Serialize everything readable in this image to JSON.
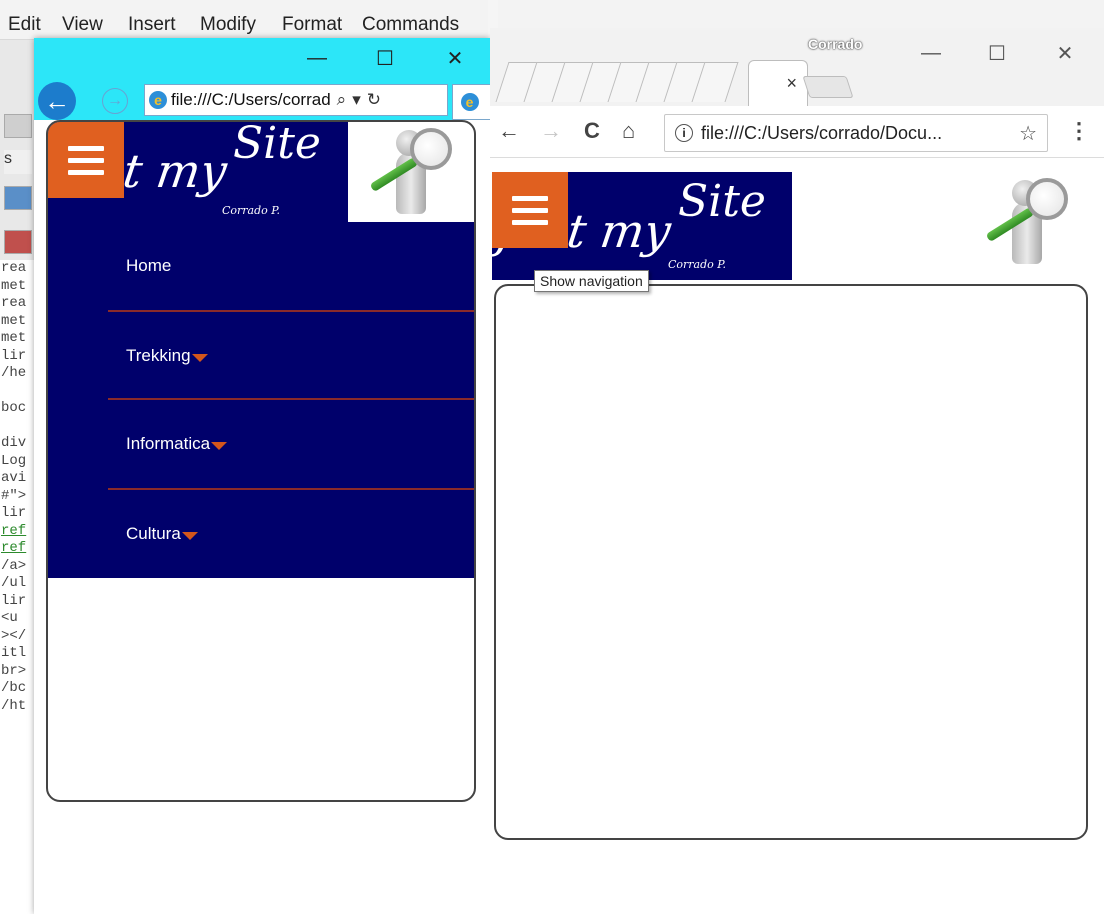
{
  "editor": {
    "menu": [
      "Edit",
      "View",
      "Insert",
      "Modify",
      "Format",
      "Commands"
    ],
    "code_lines": [
      "rea",
      "met",
      "rea",
      "met",
      "met",
      "lir",
      "/he",
      "",
      "boc",
      "",
      "div",
      "Log",
      "avi",
      "#\">",
      "lir",
      "ref",
      "ref",
      "/a>",
      "/ul",
      "lir",
      "<u",
      "></",
      "itl",
      "br>",
      "/bc",
      "/ht"
    ],
    "toolbar_fragment": "s"
  },
  "ie_window": {
    "url": "file:///C:/Users/corrad",
    "search_glyph": "⌕",
    "dropdown_glyph": "▾",
    "refresh_glyph": "↻",
    "back_glyph": "←",
    "forward_glyph": "→",
    "minimize_glyph": "—",
    "maximize_glyph": "☐",
    "close_glyph": "✕",
    "logo_glyph": "e"
  },
  "site": {
    "logo_script": "Just my",
    "logo_site": "Site",
    "logo_signature": "Corrado P.",
    "nav": [
      {
        "label": "Home",
        "has_submenu": false
      },
      {
        "label": "Trekking",
        "has_submenu": true
      },
      {
        "label": "Informatica",
        "has_submenu": true
      },
      {
        "label": "Cultura",
        "has_submenu": true
      }
    ],
    "accent_color": "#e06020",
    "banner_color": "#00006b"
  },
  "chrome_window": {
    "profile_name": "Corrado",
    "tab_close_glyph": "×",
    "url": "file:///C:/Users/corrado/Docu...",
    "info_glyph": "i",
    "star_glyph": "☆",
    "menu_glyph": "⋮",
    "back_glyph": "←",
    "forward_glyph": "→",
    "reload_glyph": "C",
    "home_glyph": "⌂",
    "minimize_glyph": "—",
    "maximize_glyph": "☐",
    "close_glyph": "✕",
    "tooltip": "Show navigation"
  }
}
